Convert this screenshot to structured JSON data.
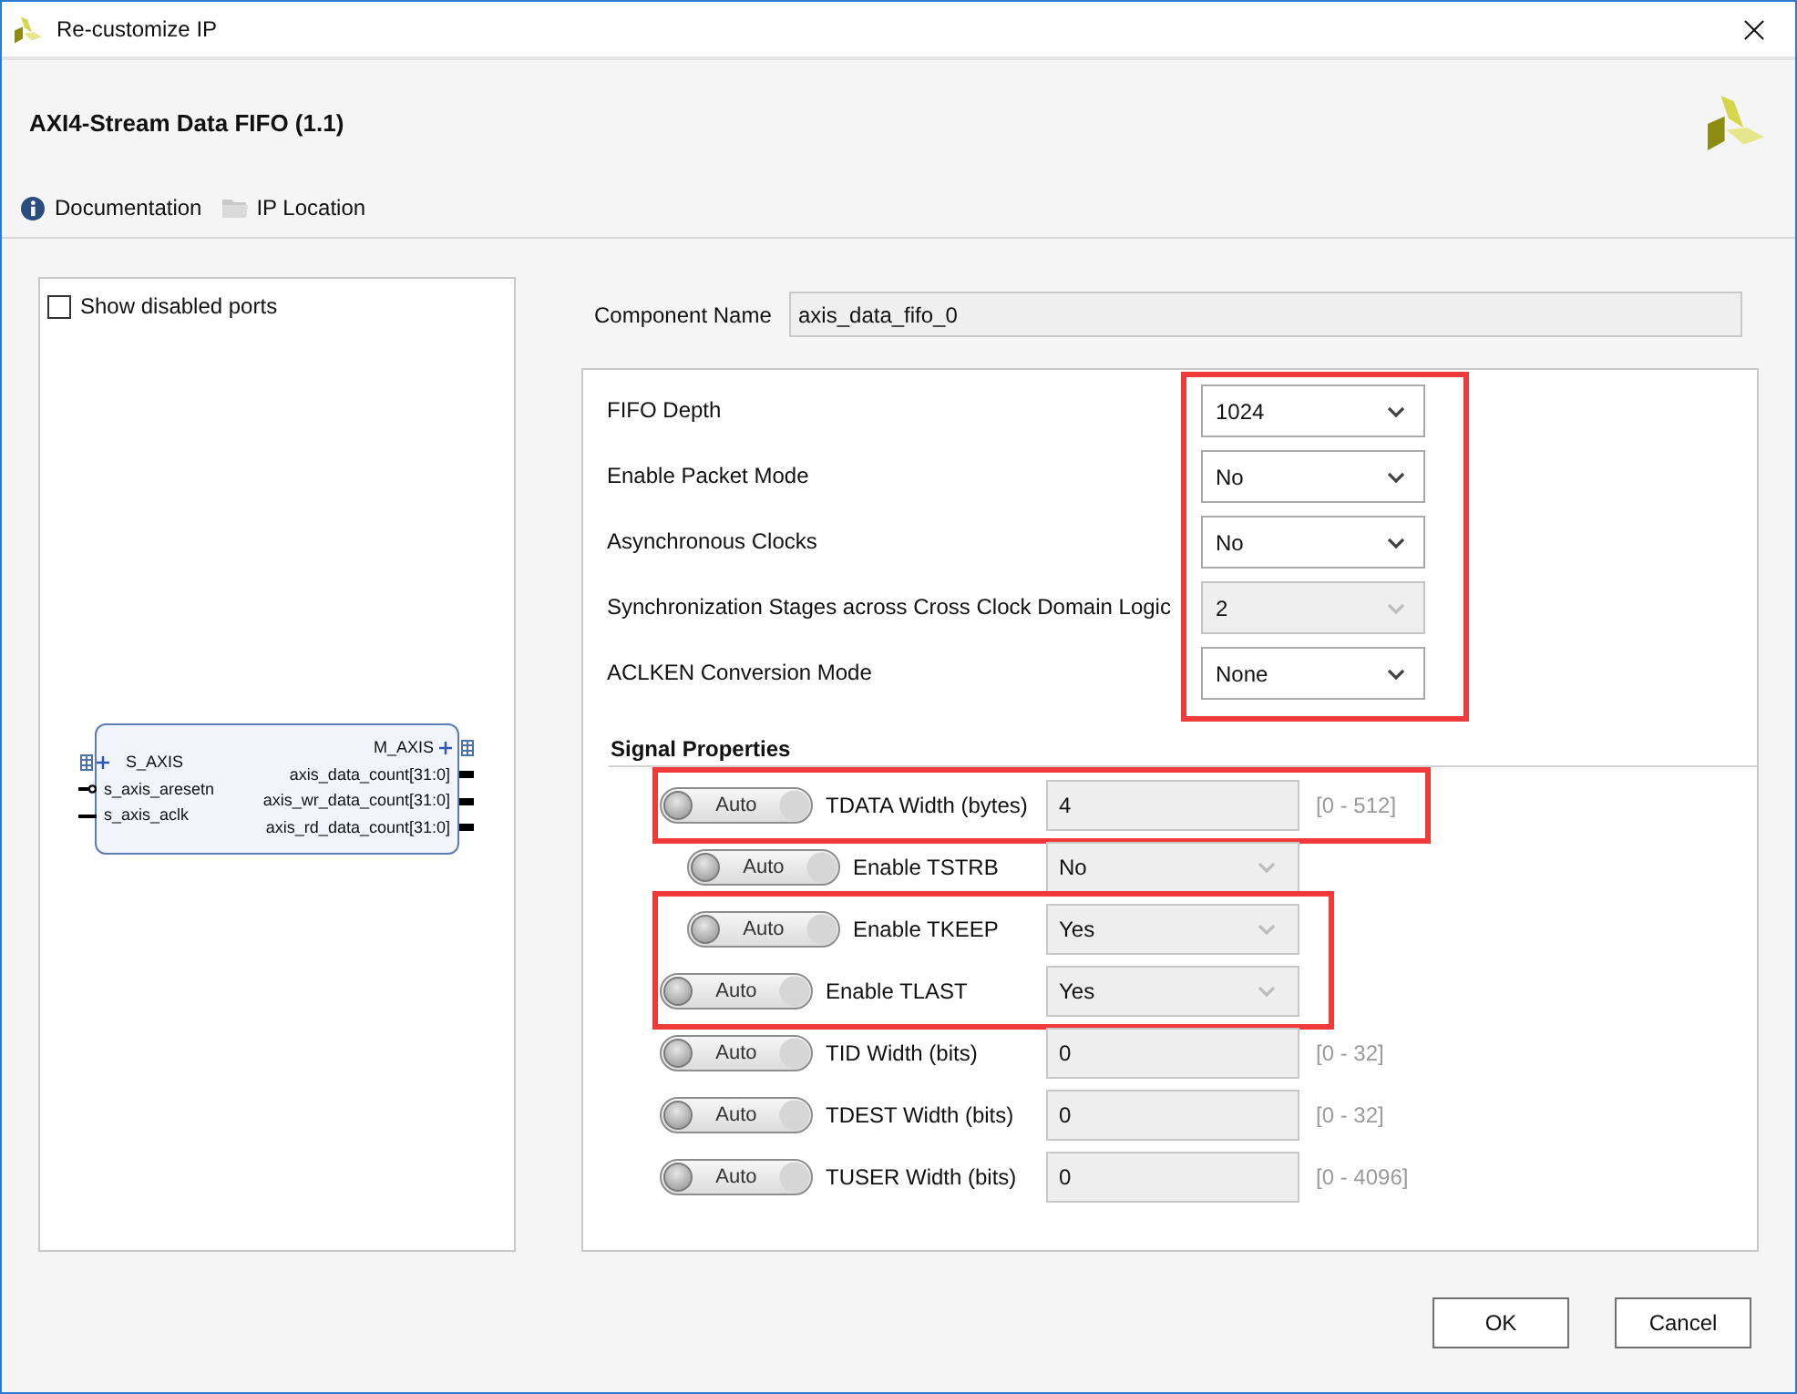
{
  "window": {
    "title": "Re-customize IP"
  },
  "header": {
    "title": "AXI4-Stream Data FIFO (1.1)",
    "toolbar": [
      {
        "kind": "info",
        "label": "Documentation"
      },
      {
        "kind": "folder",
        "label": "IP Location"
      }
    ]
  },
  "symbol_panel": {
    "show_disabled_ports": {
      "label": "Show disabled ports",
      "checked": false
    },
    "block": {
      "left_ports": [
        {
          "kind": "bus",
          "name": "S_AXIS"
        },
        {
          "kind": "reset",
          "name": "s_axis_aresetn"
        },
        {
          "kind": "clock",
          "name": "s_axis_aclk"
        }
      ],
      "right_ports": [
        {
          "kind": "bus",
          "name": "M_AXIS"
        },
        {
          "kind": "vector",
          "name": "axis_data_count[31:0]"
        },
        {
          "kind": "vector",
          "name": "axis_wr_data_count[31:0]"
        },
        {
          "kind": "vector",
          "name": "axis_rd_data_count[31:0]"
        }
      ]
    }
  },
  "component_name": {
    "label": "Component Name",
    "value": "axis_data_fifo_0"
  },
  "parameters": {
    "highlighted": true,
    "rows": [
      {
        "label": "FIFO Depth",
        "value": "1024",
        "disabled": false
      },
      {
        "label": "Enable Packet Mode",
        "value": "No",
        "disabled": false
      },
      {
        "label": "Asynchronous Clocks",
        "value": "No",
        "disabled": false
      },
      {
        "label": "Synchronization Stages across Cross Clock Domain Logic",
        "value": "2",
        "disabled": true
      },
      {
        "label": "ACLKEN Conversion Mode",
        "value": "None",
        "disabled": false
      }
    ]
  },
  "signal_properties": {
    "title": "Signal Properties",
    "rows": [
      {
        "toggle": "Auto",
        "on": false,
        "label": "TDATA Width (bytes)",
        "kind": "input",
        "value": "4",
        "disabled": true,
        "range": "[0 - 512]",
        "highlighted": true,
        "children": [
          {
            "toggle": "Auto",
            "on": false,
            "label": "Enable TSTRB",
            "kind": "select",
            "value": "No",
            "disabled": true,
            "highlighted": false
          },
          {
            "toggle": "Auto",
            "on": false,
            "label": "Enable TKEEP",
            "kind": "select",
            "value": "Yes",
            "disabled": true,
            "highlighted": true
          }
        ]
      },
      {
        "toggle": "Auto",
        "on": false,
        "label": "Enable TLAST",
        "kind": "select",
        "value": "Yes",
        "disabled": true,
        "highlighted": true
      },
      {
        "toggle": "Auto",
        "on": false,
        "label": "TID Width (bits)",
        "kind": "input",
        "value": "0",
        "disabled": true,
        "range": "[0 - 32]",
        "highlighted": false
      },
      {
        "toggle": "Auto",
        "on": false,
        "label": "TDEST Width (bits)",
        "kind": "input",
        "value": "0",
        "disabled": true,
        "range": "[0 - 32]",
        "highlighted": false
      },
      {
        "toggle": "Auto",
        "on": false,
        "label": "TUSER Width (bits)",
        "kind": "input",
        "value": "0",
        "disabled": true,
        "range": "[0 - 4096]",
        "highlighted": false
      }
    ]
  },
  "buttons": [
    "OK",
    "Cancel"
  ]
}
